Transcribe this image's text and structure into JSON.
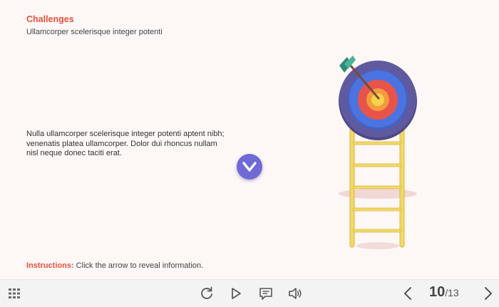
{
  "slide": {
    "title": "Challenges",
    "subtitle": "Ullamcorper scelerisque integer potenti",
    "body": "Nulla ullamcorper scelerisque integer potenti aptent nibh; venenatis platea ullamcorper. Dolor dui rhoncus nullam nisl neque donec taciti erat.",
    "instructions_label": "Instructions:",
    "instructions_text": " Click the arrow to reveal information.",
    "accent_color": "#e8503a",
    "button_color": "#6f6ad6"
  },
  "toolbar": {
    "menu_icon": "grid-menu-icon",
    "replay_icon": "replay-icon",
    "play_icon": "play-icon",
    "captions_icon": "captions-icon",
    "volume_icon": "volume-icon",
    "prev_icon": "chevron-left-icon",
    "next_icon": "chevron-right-icon",
    "page_current": "10",
    "page_total": "/13"
  }
}
